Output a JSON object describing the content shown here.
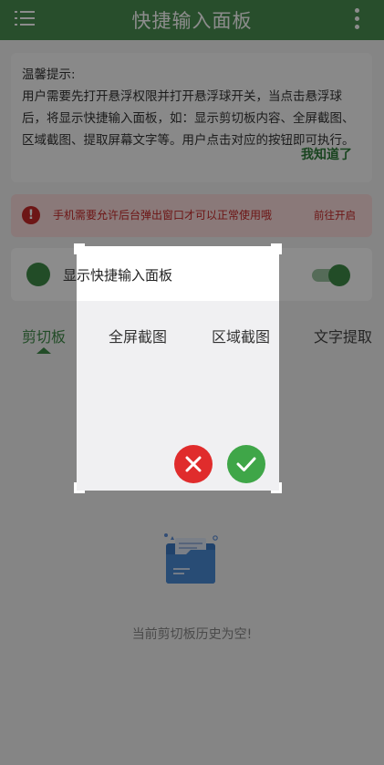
{
  "header": {
    "title": "快捷输入面板",
    "menu_icon": "menu-icon",
    "more_icon": "more-vertical-icon"
  },
  "tip": {
    "title": "温馨提示:",
    "body": "用户需要先打开悬浮权限并打开悬浮球开关，当点击悬浮球后，将显示快捷输入面板，如：显示剪切板内容、全屏截图、区域截图、提取屏幕文字等。用户点击对应的按钮即可执行。",
    "ack": "我知道了"
  },
  "warning": {
    "icon": "alert-icon",
    "text": "手机需要允许后台弹出窗口才可以正常使用哦",
    "link": "前往开启"
  },
  "toggle": {
    "label": "显示快捷输入面板",
    "enabled": true
  },
  "tabs": [
    {
      "label": "剪切板",
      "active": true
    },
    {
      "label": "全屏截图",
      "active": false
    },
    {
      "label": "区域截图",
      "active": false
    },
    {
      "label": "文字提取",
      "active": false
    }
  ],
  "empty_state": {
    "text": "当前剪切板历史为空!",
    "icon": "empty-folder-icon"
  },
  "colors": {
    "primary": "#4a8f50",
    "accent_green": "#3e8b48",
    "warning_red": "#c62828",
    "cancel_red": "#e02c2c",
    "confirm_green": "#3fa648"
  }
}
